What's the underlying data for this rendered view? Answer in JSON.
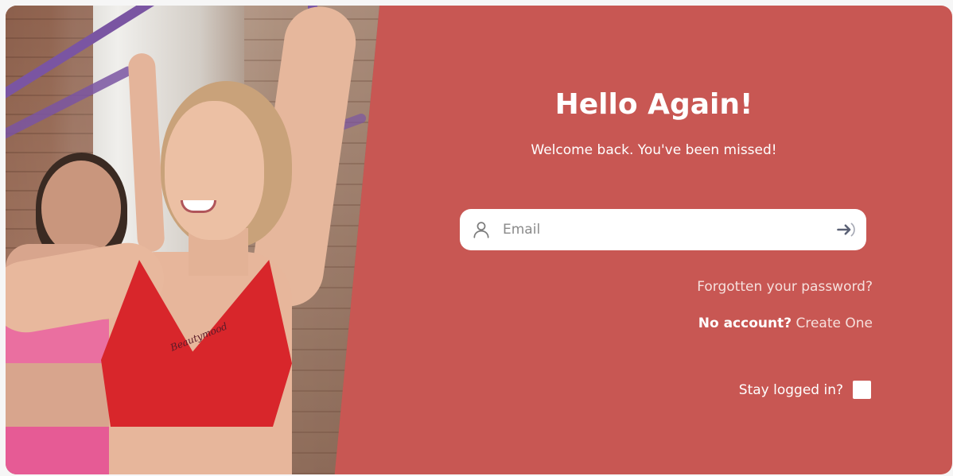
{
  "login": {
    "title": "Hello Again!",
    "subtitle": "Welcome back. You've been missed!",
    "email_placeholder": "Email",
    "email_value": "",
    "forgot_password": "Forgotten your password?",
    "no_account": "No account?",
    "create_one": "Create One",
    "stay_logged_in": "Stay logged in?",
    "stay_logged_in_checked": false
  },
  "photo": {
    "brand_text": "Beautymood"
  },
  "icons": {
    "email_field": "user-icon",
    "submit": "arrow-right-icon"
  },
  "colors": {
    "panel_bg": "#c85753",
    "text": "#ffffff",
    "input_bg": "#ffffff",
    "icon": "#5b6175"
  }
}
